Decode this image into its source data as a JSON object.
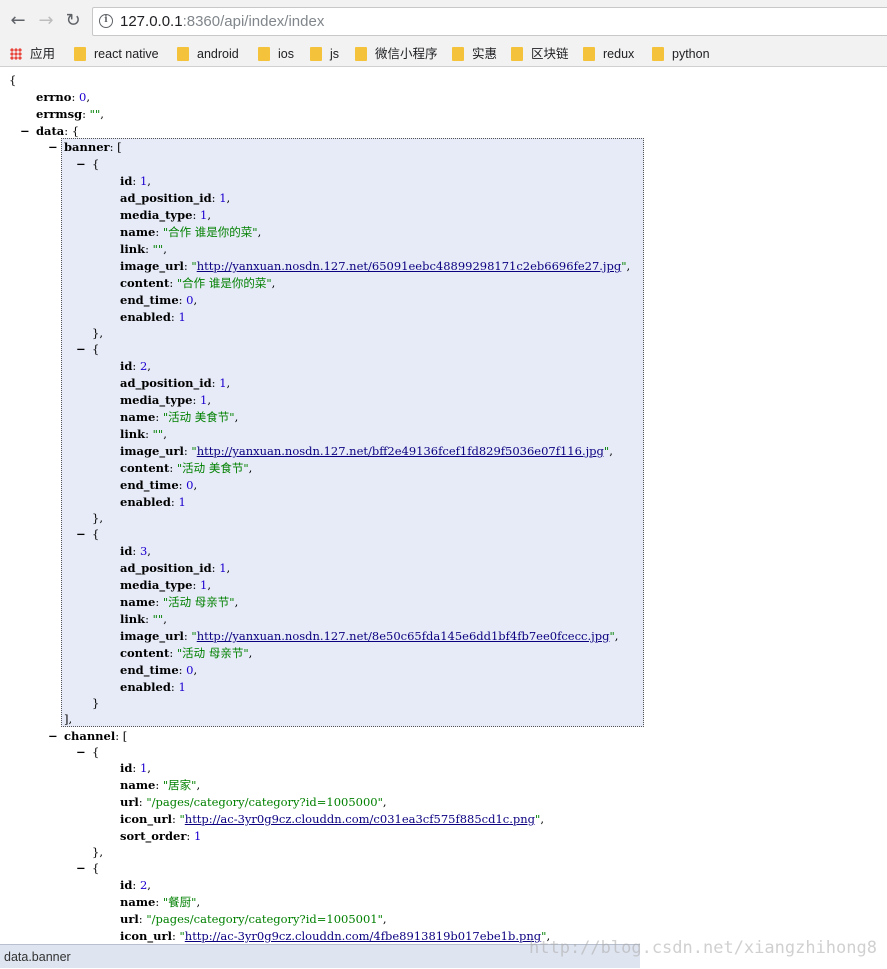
{
  "browser": {
    "url_host": "127.0.0.1",
    "url_rest": ":8360/api/index/index",
    "back_icon": "arrow-left-icon",
    "forward_icon": "arrow-right-icon",
    "reload_icon": "reload-icon",
    "info_icon": "info-icon",
    "bookmarks": [
      "应用",
      "react native",
      "android",
      "ios",
      "js",
      "微信小程序",
      "实惠",
      "区块链",
      "redux",
      "python"
    ]
  },
  "json": {
    "open_brace": "{",
    "errno_key": "errno",
    "errno_val": "0",
    "errmsg_key": "errmsg",
    "errmsg_val": "\"\"",
    "data_key": "data",
    "banner_key": "banner",
    "banner": [
      {
        "id": "1",
        "ad_position_id": "1",
        "media_type": "1",
        "name": "\"合作 谁是你的菜\"",
        "link": "\"\"",
        "image_url": "http://yanxuan.nosdn.127.net/65091eebc48899298171c2eb6696fe27.jpg",
        "content": "\"合作 谁是你的菜\"",
        "end_time": "0",
        "enabled": "1"
      },
      {
        "id": "2",
        "ad_position_id": "1",
        "media_type": "1",
        "name": "\"活动 美食节\"",
        "link": "\"\"",
        "image_url": "http://yanxuan.nosdn.127.net/bff2e49136fcef1fd829f5036e07f116.jpg",
        "content": "\"活动 美食节\"",
        "end_time": "0",
        "enabled": "1"
      },
      {
        "id": "3",
        "ad_position_id": "1",
        "media_type": "1",
        "name": "\"活动 母亲节\"",
        "link": "\"\"",
        "image_url": "http://yanxuan.nosdn.127.net/8e50c65fda145e6dd1bf4fb7ee0fcecc.jpg",
        "content": "\"活动 母亲节\"",
        "end_time": "0",
        "enabled": "1"
      }
    ],
    "channel_key": "channel",
    "channel": [
      {
        "id": "1",
        "name": "\"居家\"",
        "url": "\"/pages/category/category?id=1005000\"",
        "icon_url": "http://ac-3yr0g9cz.clouddn.com/c031ea3cf575f885cd1c.png",
        "sort_order": "1"
      },
      {
        "id": "2",
        "name": "\"餐厨\"",
        "url": "\"/pages/category/category?id=1005001\"",
        "icon_url": "http://ac-3yr0g9cz.clouddn.com/4fbe8913819b017ebe1b.png"
      }
    ]
  },
  "status_text": "data.banner",
  "watermark": "http://blog.csdn.net/xiangzhihong8",
  "colors": {
    "number": "#1c00cf",
    "string": "#008000",
    "link": "#0b0080",
    "highlight": "#e7ebf7"
  }
}
